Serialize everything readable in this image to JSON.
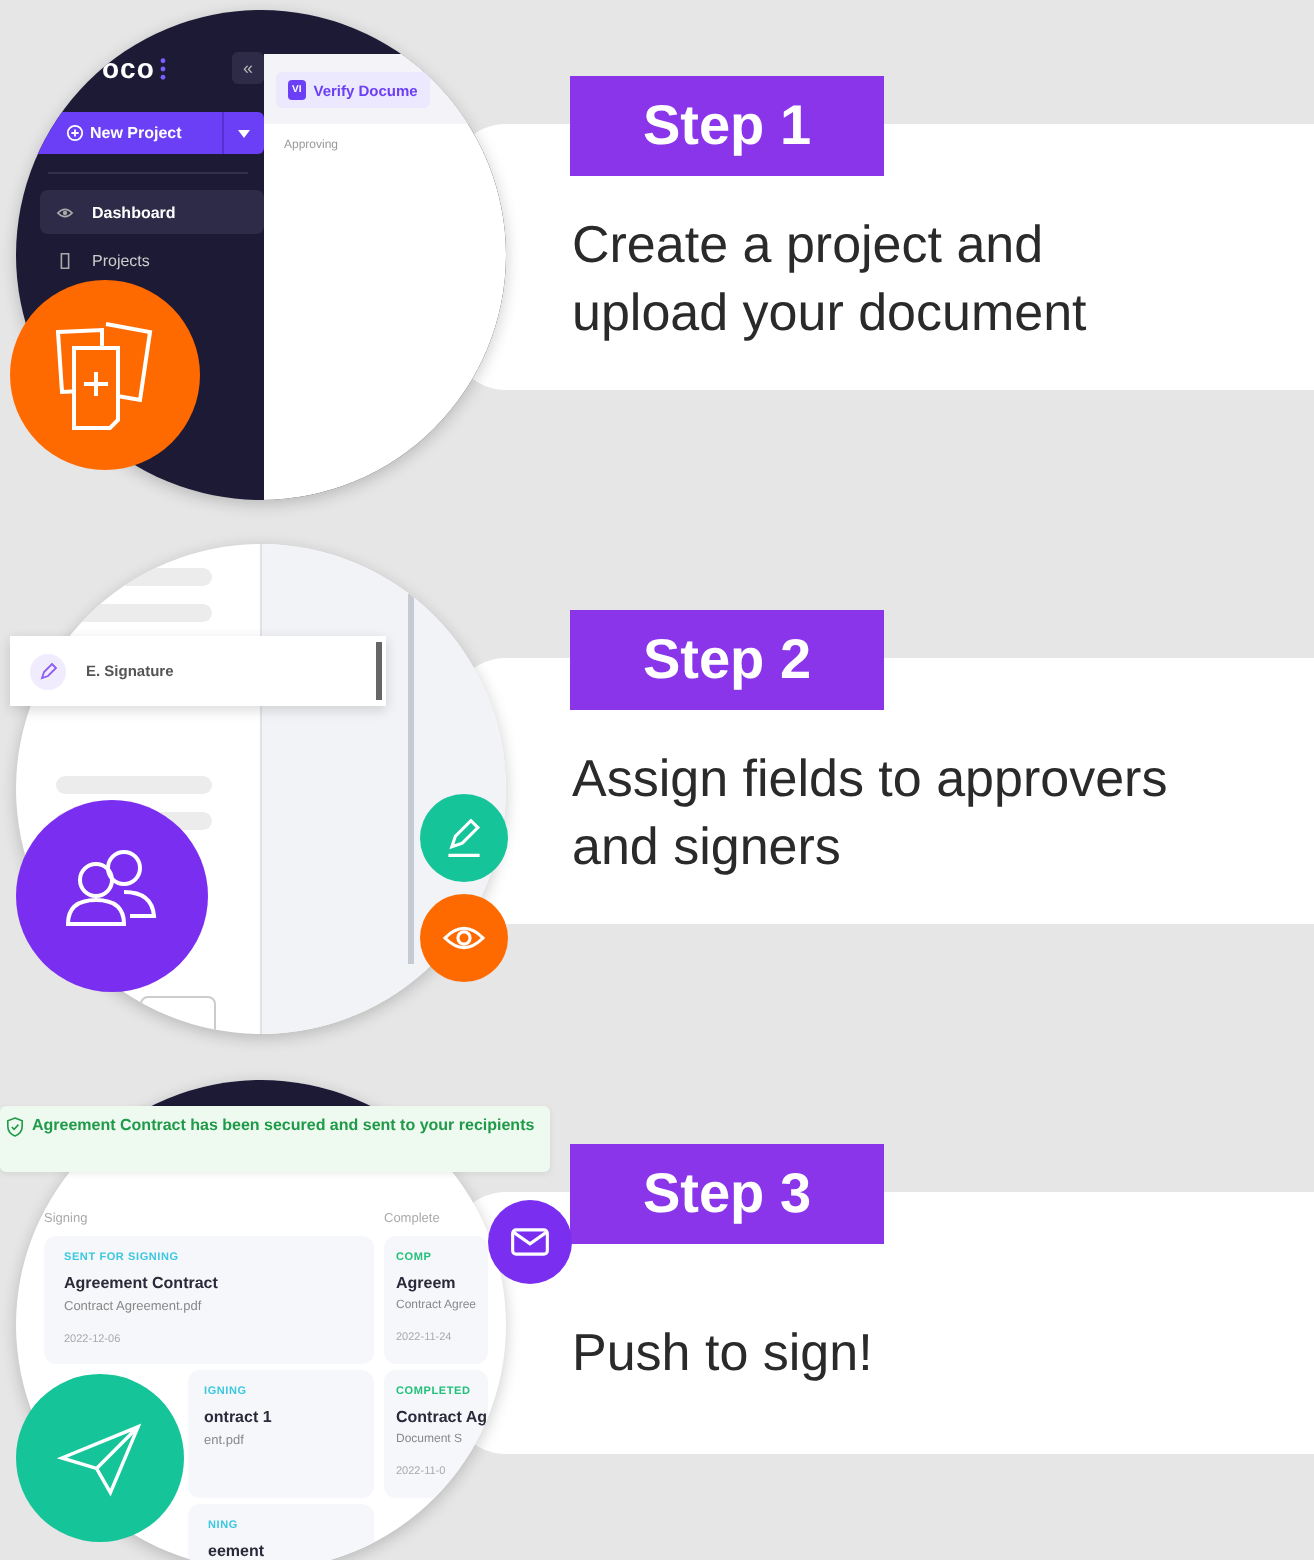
{
  "steps": [
    {
      "label": "Step 1",
      "text": "Create a project and\nupload your document",
      "kind": "project",
      "screen": {
        "logo": "oco",
        "collapse": "«",
        "new_project": "New Project",
        "nav": [
          {
            "label": "Dashboard",
            "selected": true
          },
          {
            "label": "Projects",
            "selected": false
          }
        ],
        "tab_badge": "VI",
        "tab": "Verify Docume",
        "section": "Approving"
      }
    },
    {
      "label": "Step 2",
      "text": "Assign fields to approvers\nand signers",
      "kind": "fields",
      "screen": {
        "field": "E. Signature"
      }
    },
    {
      "label": "Step 3",
      "text": "Push to sign!",
      "kind": "push",
      "screen": {
        "toast": "Agreement Contract has been secured and sent to your recipients",
        "columns": [
          {
            "title": "Signing",
            "cards": [
              {
                "kind": "signing",
                "status": "SENT FOR SIGNING",
                "title": "Agreement Contract",
                "file": "Contract Agreement.pdf",
                "date": "2022-12-06"
              },
              {
                "kind": "signing",
                "status": "IGNING",
                "title": "ontract 1",
                "file": "ent.pdf"
              },
              {
                "kind": "signing",
                "status": "NING",
                "title": "eement"
              }
            ]
          },
          {
            "title": "Complete",
            "cards": [
              {
                "kind": "completed",
                "status": "COMP",
                "title": "Agreem",
                "file": "Contract Agree",
                "date": "2022-11-24"
              },
              {
                "kind": "completed",
                "status": "COMPLETED",
                "title": "Contract Ag",
                "file": "Document S",
                "date": "2022-11-0"
              }
            ]
          }
        ]
      }
    }
  ]
}
